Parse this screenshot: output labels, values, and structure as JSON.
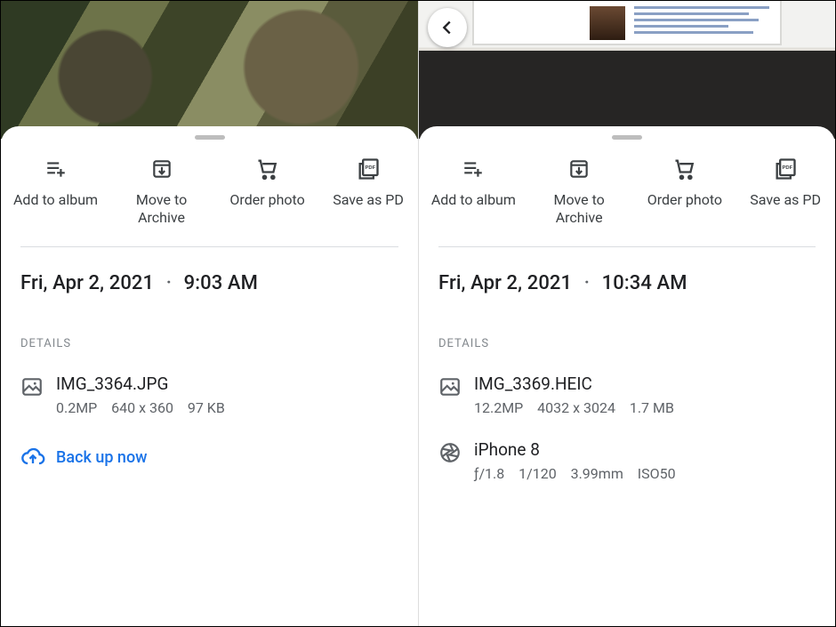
{
  "left": {
    "actions": {
      "add_to_album": "Add to album",
      "move_to_archive": "Move to Archive",
      "order_photo": "Order photo",
      "save_as_pdf": "Save as PD"
    },
    "date": "Fri, Apr 2, 2021",
    "time": "9:03 AM",
    "details_heading": "DETAILS",
    "file": {
      "name": "IMG_3364.JPG",
      "megapixels": "0.2MP",
      "dimensions": "640 x 360",
      "size": "97 KB"
    },
    "backup_label": "Back up now"
  },
  "right": {
    "actions": {
      "add_to_album": "Add to album",
      "move_to_archive": "Move to Archive",
      "order_photo": "Order photo",
      "save_as_pdf": "Save as PD"
    },
    "date": "Fri, Apr 2, 2021",
    "time": "10:34 AM",
    "details_heading": "DETAILS",
    "file": {
      "name": "IMG_3369.HEIC",
      "megapixels": "12.2MP",
      "dimensions": "4032 x 3024",
      "size": "1.7 MB"
    },
    "camera": {
      "model": "iPhone 8",
      "aperture": "ƒ/1.8",
      "shutter": "1/120",
      "focal": "3.99mm",
      "iso": "ISO50"
    }
  }
}
